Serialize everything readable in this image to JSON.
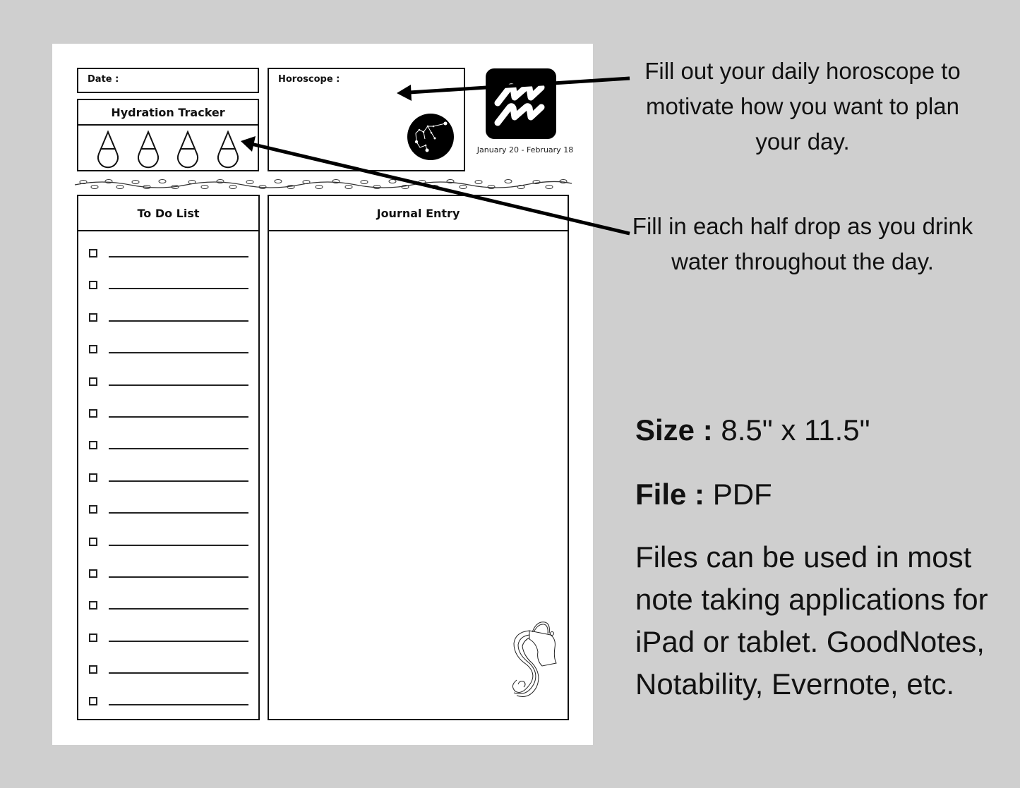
{
  "planner_page": {
    "date_label": "Date :",
    "hydration": {
      "title": "Hydration Tracker",
      "drop_count": 4,
      "drops_filled": 0
    },
    "horoscope_label": "Horoscope :",
    "zodiac": {
      "sign_icon": "aquarius-icon",
      "date_range": "January 20 - February 18"
    },
    "todo": {
      "title": "To Do List",
      "item_count": 15,
      "items": [
        "",
        "",
        "",
        "",
        "",
        "",
        "",
        "",
        "",
        "",
        "",
        "",
        "",
        "",
        ""
      ]
    },
    "journal": {
      "title": "Journal Entry",
      "body": ""
    }
  },
  "annotations": {
    "horoscope_note": "Fill out your daily horoscope to motivate how you want to plan your day.",
    "hydration_note": "Fill in each half drop as you drink water throughout the day."
  },
  "product_info": {
    "size_label": "Size :",
    "size_value": "8.5\" x 11.5\"",
    "file_label": "File :",
    "file_value": "PDF",
    "description": "Files can be used in most note taking applications for iPad or tablet. GoodNotes, Notability, Evernote, etc."
  },
  "colors": {
    "background": "#cfcfcf",
    "page": "#ffffff",
    "ink": "#111111"
  }
}
